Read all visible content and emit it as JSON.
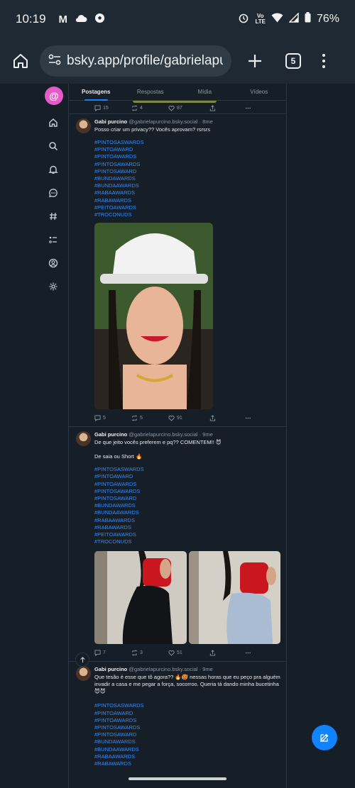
{
  "status_bar": {
    "time": "10:19",
    "battery": "76%",
    "volte_line1": "Vo",
    "volte_line2": "LTE",
    "gmail_letter": "M"
  },
  "browser": {
    "url": "bsky.app/profile/gabrielapurcino",
    "tab_count": "5"
  },
  "tabs": [
    {
      "label": "Postagens",
      "active": true
    },
    {
      "label": "Respostas",
      "active": false
    },
    {
      "label": "Mídia",
      "active": false
    },
    {
      "label": "Vídeos",
      "active": false
    }
  ],
  "top_actions": {
    "replies": "15",
    "reposts": "4",
    "likes": "87"
  },
  "posts": [
    {
      "author": "Gabi purcino",
      "handle": "@gabrielapurcino.bsky.social",
      "time": "· 8me",
      "text": "Posso criar um privacy?? Vocês aprovam? rsrsrs",
      "text2": "",
      "tags": "#PINTOSASWARDS\n#PINTOAWARD\n#PINTOAWARDS\n#PINTOSAWARDS\n#PINTOSAWARD\n#BUNDAWARDS\n#BUNDAAWARDS\n#RABAAWARDS\n#RABAWARDS\n#PEITOAWARDS\n#TROCONUDS",
      "replies": "5",
      "reposts": "5",
      "likes": "91"
    },
    {
      "author": "Gabi purcino",
      "handle": "@gabrielapurcino.bsky.social",
      "time": "· 9me",
      "text": "De que jeito vocês preferem e pq?? COMENTEM!! 😈",
      "text2": "De saia ou Short 🔥",
      "tags": "#PINTOSASWARDS\n#PINTOAWARD\n#PINTOAWARDS\n#PINTOSAWARDS\n#PINTOSAWARD\n#BUNDAWARDS\n#BUNDAAWARDS\n#RABAAWARDS\n#RABAWARDS\n#PEITOAWARDS\n#TROCONUDS",
      "replies": "7",
      "reposts": "3",
      "likes": "51"
    },
    {
      "author": "Gabi purcino",
      "handle": "@gabrielapurcino.bsky.social",
      "time": "· 9me",
      "text": "Que tesão é esse que tô agora?? 🔥🥵 nessas horas que eu peço pra alguém invadir a casa e me pegar a força, socorroo. Queria tá dando minha bucetinha 😈😈",
      "text2": "",
      "tags": "#PINTOSASWARDS\n#PINTOAWARD\n#PINTOAWARDS\n#PINTOSAWARDS\n#PINTOSAWARD\n#BUNDAWARDS\n#BUNDAAWARDS\n#RABAAWARDS\n#RABAWARDS"
    }
  ]
}
